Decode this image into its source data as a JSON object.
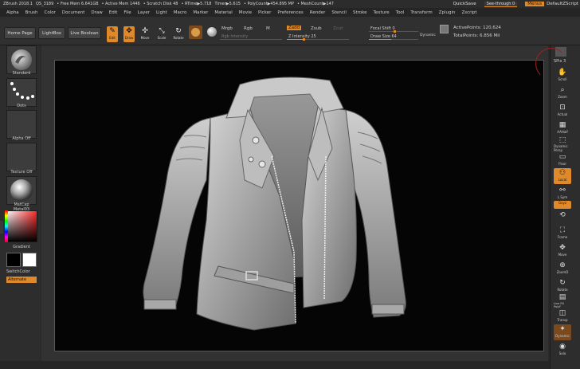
{
  "titlebar": {
    "items": [
      "ZBrush 2018.1",
      "QS_3189",
      "• Free Mem 6.641GB",
      "• Active Mem 1446",
      "• Scratch Disk 48",
      "• RTime▶5.718",
      "Timer▶5.615",
      "• PolyCount▶454.895 MP",
      "• MeshCount▶147"
    ],
    "quicksave": "QuickSave",
    "see_through": "See-through 0",
    "menus": "Menus",
    "default_script": "DefaultZScript"
  },
  "menubar": [
    "Alpha",
    "Brush",
    "Color",
    "Document",
    "Draw",
    "Edit",
    "File",
    "Layer",
    "Light",
    "Macro",
    "Marker",
    "Material",
    "Movie",
    "Picker",
    "Preferences",
    "Render",
    "Stencil",
    "Stroke",
    "Texture",
    "Tool",
    "Transform",
    "Zplugin",
    "Zscript"
  ],
  "shelf": {
    "home_page": "Home Page",
    "lightbox": "LightBox",
    "live_boolean": "Live Boolean",
    "tools": [
      {
        "label": "Edit",
        "icon": "edit-icon",
        "active": true
      },
      {
        "label": "Draw",
        "icon": "draw-icon",
        "active": true
      },
      {
        "label": "Move",
        "icon": "move-icon",
        "active": false
      },
      {
        "label": "Scale",
        "icon": "scale-icon",
        "active": false
      },
      {
        "label": "Rotate",
        "icon": "rotate-icon",
        "active": false
      }
    ],
    "mrgb": "Mrgb",
    "rgb": "Rgb",
    "m": "M",
    "zadd": "Zadd",
    "zsub": "Zsub",
    "zcut": "Zcut",
    "rgb_intensity": "Rgb Intensity",
    "z_intensity": "Z Intensity 25",
    "focal_shift": "Focal Shift 0",
    "draw_size": "Draw Size 64",
    "dynamic": "Dynamic",
    "active_points": "ActivePoints: 120,624",
    "total_points": "TotalPoints: 6.856 Mil",
    "z_intensity_value": 0.25,
    "focal_shift_value": 0.5,
    "draw_size_value": 0.45
  },
  "leftpanel": {
    "standard": "Standard",
    "dots": "Dots",
    "alpha_off": "Alpha Off",
    "texture_off": "Texture Off",
    "matcap": "MatCap Metal03",
    "gradient": "Gradient",
    "switch_color": "SwitchColor",
    "alternate": "Alternate"
  },
  "rightpanel": {
    "spix": "SPix 3",
    "tools": [
      "Scroll",
      "Zoom",
      "Actual",
      "AAHalf",
      "Dynamic Persp",
      "Floor",
      "Local",
      "L.Sym",
      "Gxyz",
      "Frame",
      "Move",
      "ZoomD",
      "Rotate",
      "Line Fill PolyF",
      "Transp",
      "Dynamic",
      "Solo"
    ]
  }
}
